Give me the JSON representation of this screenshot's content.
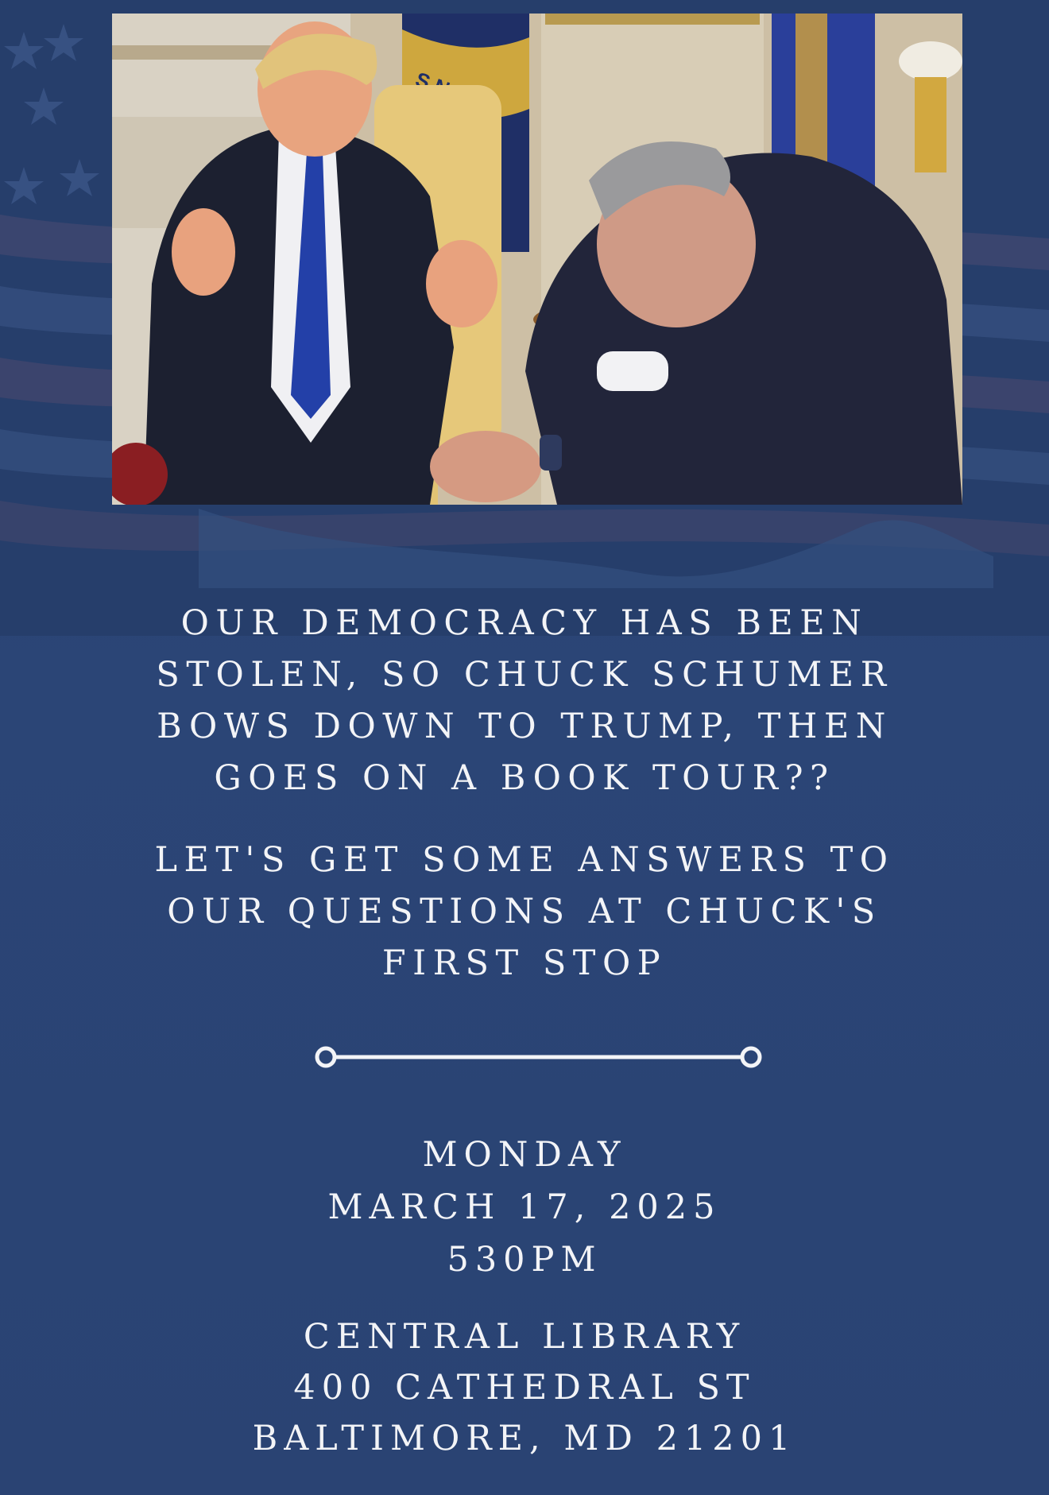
{
  "photo": {
    "icon": "photo-illustration",
    "flag_text": "S NAVY"
  },
  "headline": {
    "lines": [
      "OUR DEMOCRACY HAS BEEN",
      "STOLEN, SO CHUCK SCHUMER",
      "BOWS DOWN TO TRUMP, THEN",
      "GOES ON A BOOK TOUR??"
    ]
  },
  "subhead": {
    "lines": [
      "LET'S GET SOME ANSWERS TO",
      "OUR QUESTIONS AT CHUCK'S",
      "FIRST STOP"
    ]
  },
  "divider": {
    "icon": "line-with-circles-divider"
  },
  "event": {
    "day": "MONDAY",
    "date": "MARCH 17, 2025",
    "time": "530PM"
  },
  "venue": {
    "name": "CENTRAL LIBRARY",
    "street": "400 CATHEDRAL ST",
    "city": "BALTIMORE, MD 21201"
  },
  "colors": {
    "background": "#2a4372",
    "text": "#f3f4f7",
    "stripe_red": "#5a4a6e",
    "stripe_light": "#3d5888"
  }
}
